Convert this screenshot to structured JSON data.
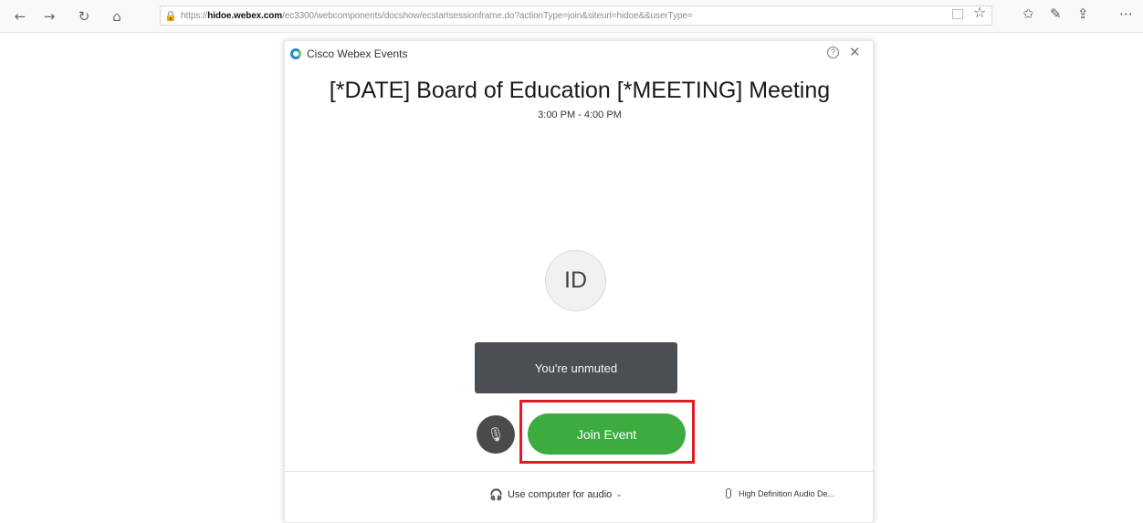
{
  "browser": {
    "back_icon": "←",
    "forward_icon": "→",
    "refresh_icon": "↻",
    "home_icon": "⌂",
    "lock_icon": "🔒",
    "url_prefix": "https://",
    "url_host": "hidoe.webex.com",
    "url_path": "/ec3300/webcomponents/docshow/ecstartsessionframe.do?actionType=join&siteurl=hidoe&&userType=",
    "favorite_icon": "☆",
    "favorites_icon": "✩",
    "pen_icon": "✎",
    "share_icon": "⇪",
    "more_icon": "⋯"
  },
  "webex": {
    "app_name": "Cisco Webex Events",
    "help_icon": "?",
    "close_icon": "✕",
    "meeting_title": "[*DATE] Board of Education [*MEETING] Meeting",
    "meeting_time": "3:00 PM - 4:00 PM",
    "avatar_initials": "ID",
    "toast_text": "You're unmuted",
    "mic_icon": "🎙",
    "join_button_label": "Join Event",
    "audio_option_label": "Use computer for audio",
    "audio_icon": "🎧",
    "chevron": "⌄",
    "device_label": "High Definition Audio De..."
  },
  "colors": {
    "join_button": "#3dab3f",
    "highlight": "#e11c25",
    "toast": "#4b4f52"
  }
}
